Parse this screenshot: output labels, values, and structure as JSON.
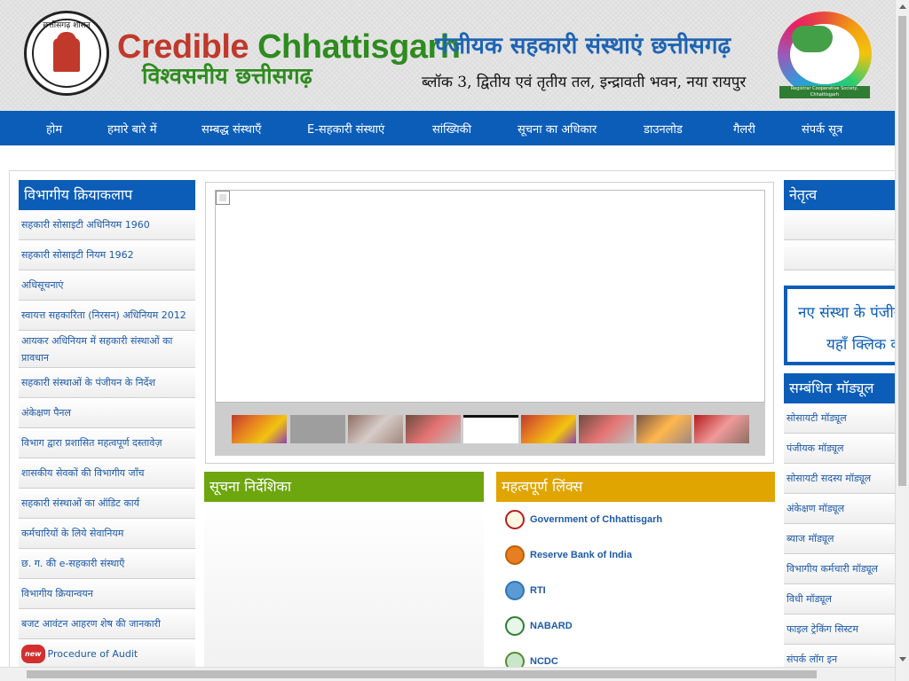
{
  "header": {
    "emblem_text": "छत्तीसगढ़ शासन",
    "brand_en_1": "Credible ",
    "brand_en_2": "Chhattisgarh",
    "brand_hi": "विश्वसनीय छत्तीसगढ़",
    "office_title": "पंजीयक सहकारी संस्थाएं छत्तीसगढ़",
    "office_address": "ब्लॉक 3, द्वितीय एवं तृतीय तल, इन्द्रावती भवन, नया रायपुर",
    "logo_caption": "Registrar Cooperative Society, Chhattisgarh"
  },
  "nav": [
    {
      "label": "होम"
    },
    {
      "label": "हमारे बारे में"
    },
    {
      "label": "सम्बद्ध संस्थाएँ"
    },
    {
      "label": "E-सहकारी संस्थाएं"
    },
    {
      "label": "सांख्यिकी"
    },
    {
      "label": "सूचना का अधिकार"
    },
    {
      "label": "डाउनलोड"
    },
    {
      "label": "गैलरी"
    },
    {
      "label": "संपर्क सूत्र"
    }
  ],
  "left_panel": {
    "title": "विभागीय क्रियाकलाप",
    "items": [
      "सहकारी सोसाइटी अधिनियम 1960",
      "सहकारी सोसाइटी नियम 1962",
      "अधिसूचनाएं",
      "स्वायत्त सहकारिता (निरसन) अधिनियम 2012",
      "आयकर अधिनियम में सहकारी संस्थाओं का प्रावधान",
      "सहकारी संस्थाओं के पंजीयन के निर्देश",
      "अंकेक्षण पैनल",
      "विभाग द्वारा प्रशासित महत्वपूर्ण दस्तावेज़",
      "शासकीय सेवकों की विभागीय जाँच",
      "सहकारी संस्थाओं का ऑडिट कार्य",
      "कर्मचारियों के लिये सेवानियम",
      "छ. ग. की e-सहकारी संस्थाएँ",
      "विभागीय क्रियान्वयन",
      "बजट आवंटन आहरण शेष की जानकारी",
      "Procedure of Audit"
    ],
    "new_badge": "new"
  },
  "notice_panel": {
    "title": "सूचना निर्देशिका"
  },
  "links_panel": {
    "title": "महत्वपूर्ण लिंक्स",
    "links": [
      "Government of Chhattisgarh",
      "Reserve Bank of India",
      "RTI",
      "NABARD",
      "NCDC"
    ]
  },
  "right_panel": {
    "leadership_title": "नेतृत्व",
    "promo_line1": "नए संस्था के पंजीयन",
    "promo_line2": "यहाँ क्लिक करें",
    "modules_title": "सम्बंधित मॉड्यूल",
    "modules": [
      "सोसायटी मॉड्यूल",
      "पंजीयक मॉड्यूल",
      "सोसायटी सदस्य मॉड्यूल",
      "अंकेक्षण मॉड्यूल",
      "ब्याज मॉड्यूल",
      "विभागीय कर्मचारी मॉड्यूल",
      "विधी मॉड्यूल",
      "फाइल ट्रेकिंग सिस्टम",
      "संपर्क लॉग इन"
    ]
  },
  "colors": {
    "nav_blue": "#0b5db8",
    "green": "#6ea60f",
    "gold": "#e0a500"
  }
}
